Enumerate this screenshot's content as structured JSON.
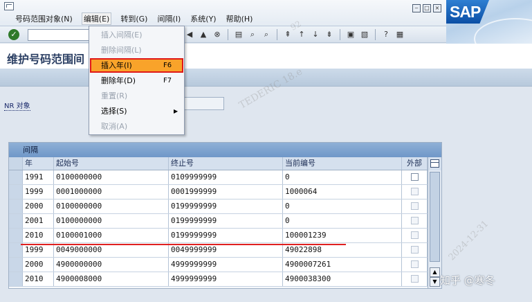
{
  "menubar": {
    "items": [
      {
        "label": "号码范围对象(N)"
      },
      {
        "label": "编辑(E)"
      },
      {
        "label": "转到(G)"
      },
      {
        "label": "间隔(I)"
      },
      {
        "label": "系统(Y)"
      },
      {
        "label": "帮助(H)"
      }
    ],
    "logo": "SAP"
  },
  "toolbar": {
    "command_value": "",
    "icons": [
      "save-icon",
      "back-icon",
      "exit-icon",
      "cancel-icon",
      "print-icon",
      "find-icon",
      "find-next-icon",
      "first-page-icon",
      "prev-page-icon",
      "next-page-icon",
      "last-page-icon",
      "new-session-icon",
      "shortcut-icon",
      "help-icon",
      "layout-icon"
    ]
  },
  "page": {
    "title": "维护号码范围间"
  },
  "nr_object": {
    "label": "NR 对象",
    "value": ""
  },
  "dropdown": {
    "items": [
      {
        "label": "插入间隔(E)",
        "shortcut": "",
        "state": "disabled"
      },
      {
        "label": "删除间隔(L)",
        "shortcut": "",
        "state": "disabled"
      },
      {
        "label": "插入年(I)",
        "shortcut": "F6",
        "state": "highlighted"
      },
      {
        "label": "删除年(D)",
        "shortcut": "F7",
        "state": "enabled"
      },
      {
        "label": "重置(R)",
        "shortcut": "",
        "state": "disabled"
      },
      {
        "label": "选择(S)",
        "shortcut": "",
        "state": "submenu"
      },
      {
        "label": "取消(A)",
        "shortcut": "",
        "state": "disabled"
      }
    ]
  },
  "table": {
    "caption": "间隔",
    "columns": [
      "年",
      "起始号",
      "终止号",
      "当前编号",
      "外部"
    ],
    "rows": [
      {
        "year": "1991",
        "from": "0100000000",
        "to": "0109999999",
        "current": "0",
        "external": false
      },
      {
        "year": "1999",
        "from": "0001000000",
        "to": "0001999999",
        "current": "1000064",
        "external": false
      },
      {
        "year": "2000",
        "from": "0100000000",
        "to": "0199999999",
        "current": "0",
        "external": false
      },
      {
        "year": "2001",
        "from": "0100000000",
        "to": "0199999999",
        "current": "0",
        "external": false
      },
      {
        "year": "2010",
        "from": "0100001000",
        "to": "0199999999",
        "current": "100001239",
        "external": false
      },
      {
        "year": "1999",
        "from": "0049000000",
        "to": "0049999999",
        "current": "49022898",
        "external": false
      },
      {
        "year": "2000",
        "from": "4900000000",
        "to": "4999999999",
        "current": "4900007261",
        "external": false
      },
      {
        "year": "2010",
        "from": "4900008000",
        "to": "4999999999",
        "current": "4900038300",
        "external": false
      }
    ]
  },
  "watermarks": {
    "a": "TEDERIC 18.e",
    "b": "2024-12-31",
    "c": "92"
  },
  "credit": "知乎 @寒冬",
  "colors": {
    "highlight": "#f9a32a",
    "annotation_red": "#e02020",
    "sap_blue": "#0b4fa5"
  }
}
